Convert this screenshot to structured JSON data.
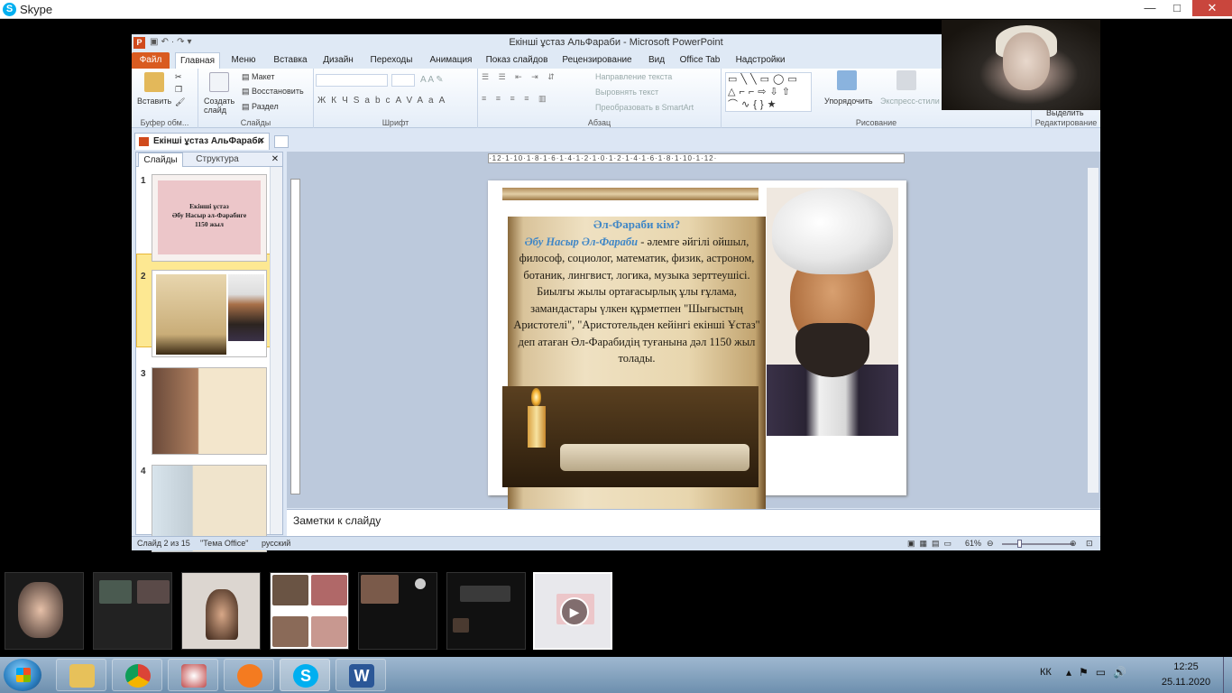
{
  "skype": {
    "title": "Skype",
    "min": "—",
    "max": "□",
    "close": "✕"
  },
  "ppt": {
    "window_title": "Екінші ұстаз АльФараби - Microsoft PowerPoint",
    "tabs": [
      "Файл",
      "Главная",
      "Меню",
      "Вставка",
      "Дизайн",
      "Переходы",
      "Анимация",
      "Показ слайдов",
      "Рецензирование",
      "Вид",
      "Office Tab",
      "Надстройки"
    ],
    "ribbon": {
      "clipboard": {
        "paste": "Вставить",
        "label": "Буфер обм..."
      },
      "slides": {
        "new_slide": "Создать слайд",
        "layout": "Макет",
        "reset": "Восстановить",
        "section": "Раздел",
        "label": "Слайды"
      },
      "font": {
        "label": "Шрифт",
        "bold": "Ж",
        "italic": "К",
        "underline": "Ч",
        "strike": "S",
        "shadow": "abc",
        "spacing": "AV",
        "case": "Aa"
      },
      "paragraph": {
        "text_direction": "Направление текста",
        "align_text": "Выровнять текст",
        "smartart": "Преобразовать в SmartArt",
        "label": "Абзац"
      },
      "drawing": {
        "arrange": "Упорядочить",
        "quick_styles": "Экспресс-стили",
        "label": "Рисование"
      },
      "editing": {
        "label": "Редактирование",
        "select": "Выделить"
      }
    },
    "doc_tab": "Екінші ұстаз АльФараби",
    "panel_tabs": {
      "slides": "Слайды",
      "outline": "Структура"
    },
    "thumbs": [
      {
        "num": "1",
        "text": "Екінші ұстаз\nӘбу Насыр әл-Фарабиге\n1150 жыл"
      },
      {
        "num": "2"
      },
      {
        "num": "3"
      },
      {
        "num": "4"
      }
    ],
    "ruler": "·12·1·10·1·8·1·6·1·4·1·2·1·0·1·2·1·4·1·6·1·8·1·10·1·12·",
    "slide": {
      "title": "Әл-Фараби кім?",
      "name": "Әбу Насыр Әл-Фараби",
      "body": " - әлемге әйгілі ойшыл, философ, социолог, математик, физик, астроном, ботаник, лингвист, логика, музыка зерттеушісі.   Биылғы жылы ортағасырлық ұлы ғұлама, замандастары үлкен құрметпен \"Шығыстың Аристотелі\", \"Аристотельден кейінгі екінші Ұстаз\" деп атаған Әл-Фарабидің туғанына дәл 1150 жыл толады."
    },
    "notes_placeholder": "Заметки к слайду",
    "status": {
      "slide": "Слайд 2 из 15",
      "theme": "\"Тема Office\"",
      "lang": "русский",
      "zoom": "61%"
    }
  },
  "taskbar": {
    "lang": "КК",
    "time": "12:25",
    "date": "25.11.2020"
  }
}
